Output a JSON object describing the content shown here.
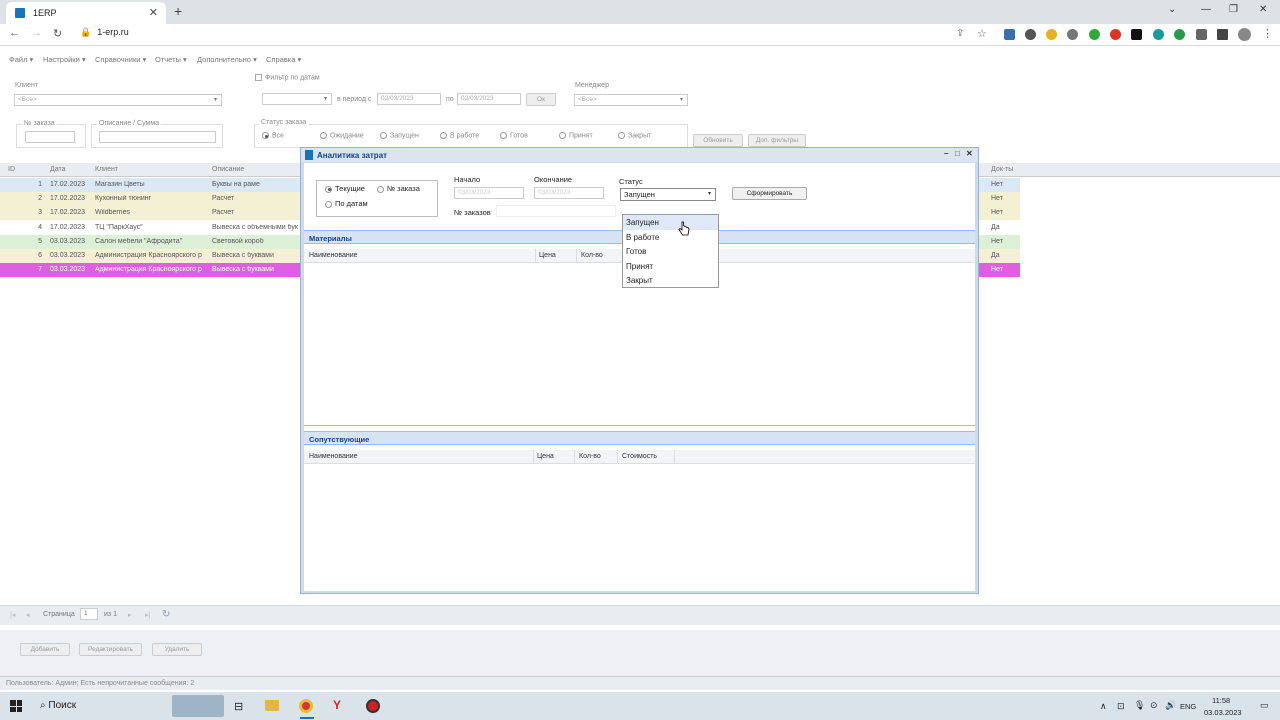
{
  "browser": {
    "tab_title": "1ERP",
    "url": "1-erp.ru"
  },
  "menu": [
    "Файл ▾",
    "Настройки ▾",
    "Справочники ▾",
    "Отчеты ▾",
    "Дополнительно ▾",
    "Справка ▾"
  ],
  "filters": {
    "client_label": "Клиент",
    "client_value": "<Все>",
    "date_filter_label": "Фильтр по датам",
    "period_from_label": "в период с",
    "date_from": "03/03/2023",
    "period_to_label": "по",
    "date_to": "03/03/2023",
    "ok_label": "Ок",
    "manager_label": "Менеджер",
    "manager_value": "<Все>",
    "order_no_label": "№ заказа",
    "description_label": "Описание / Сумма",
    "status_label": "Статус заказа",
    "statuses": [
      "Все",
      "Ожидание",
      "Запущен",
      "В работе",
      "Готов",
      "Принят",
      "Закрыт"
    ],
    "refresh_label": "Обновить",
    "extra_filters_label": "Доп. фильтры"
  },
  "grid": {
    "headers": {
      "id": "ID",
      "date": "Дата",
      "client": "Клиент",
      "description": "Описание",
      "docs": "Док-ты"
    },
    "rows": [
      {
        "id": "1",
        "date": "17.02.2023",
        "client": "Магазин Цветы",
        "description": "Буквы на раме",
        "docs": "Нет",
        "bg": "#dbe9f4"
      },
      {
        "id": "2",
        "date": "17.02.2023",
        "client": "Кухонный тюнинг",
        "description": "Расчет",
        "docs": "Нет",
        "bg": "#f3f0d4"
      },
      {
        "id": "3",
        "date": "17.02.2023",
        "client": "Wildberries",
        "description": "Расчет",
        "docs": "Нет",
        "bg": "#f3f0d4"
      },
      {
        "id": "4",
        "date": "17.02.2023",
        "client": "ТЦ \"ПаркХаус\"",
        "description": "Вывеска с объемными бук",
        "docs": "Да",
        "bg": "#ffffff"
      },
      {
        "id": "5",
        "date": "03.03.2023",
        "client": "Салон мебели \"Афродита\"",
        "description": "Световой короб",
        "docs": "Нет",
        "bg": "#dcf0d8"
      },
      {
        "id": "6",
        "date": "03.03.2023",
        "client": "Администрация Красноярского р",
        "description": "Вывеска с буквами",
        "docs": "Да",
        "bg": "#f3f0d4"
      },
      {
        "id": "7",
        "date": "03.03.2023",
        "client": "Администрация Красноярского р",
        "description": "Вывеска с буквами",
        "docs": "Нет",
        "bg": "#e05ee0"
      }
    ]
  },
  "pager": {
    "page_label": "Страница",
    "page_value": "1",
    "of_label": "из 1"
  },
  "actions": {
    "add": "Добавить",
    "edit": "Редактировать",
    "delete": "Удалить"
  },
  "status_text": "Пользователь: Админ; Есть непрочитанные сообщения: 2",
  "modal": {
    "title": "Аналитика затрат",
    "radio_current": "Текущие",
    "radio_order_no": "№ заказа",
    "radio_by_dates": "По датам",
    "start_label": "Начало",
    "start_value": "03/03/2023",
    "end_label": "Окончание",
    "end_value": "03/03/2023",
    "status_label": "Статус",
    "status_value": "Запущен",
    "orders_label": "№ заказов",
    "generate_label": "Сформировать",
    "materials_title": "Материалы",
    "materials_cols": [
      "Наименование",
      "Цена",
      "Кол-во"
    ],
    "related_title": "Сопутствующие",
    "related_cols": [
      "Наименование",
      "Цена",
      "Кол-во",
      "Стоимость"
    ],
    "status_options": [
      "Запущен",
      "В работе",
      "Готов",
      "Принят",
      "Закрыт"
    ]
  },
  "taskbar": {
    "search": "Поиск",
    "lang": "ENG",
    "time": "11:58",
    "date": "03.03.2023"
  }
}
